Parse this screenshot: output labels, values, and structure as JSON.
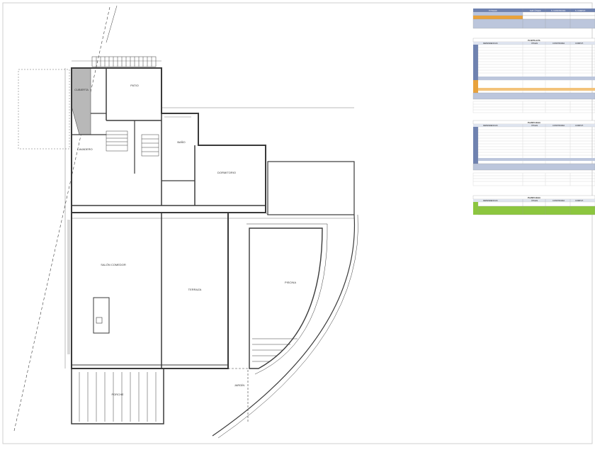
{
  "plan": {
    "rooms": {
      "cubierta": "CUBIERTA",
      "patio": "PATIO",
      "lavadero": "LAVADERO",
      "bano": "BAÑO",
      "dormitorio": "DORMITORIO",
      "salon": "SALÓN COMEDOR",
      "terraza": "TERRAZA",
      "piscina": "PISCINA",
      "porche": "PORCHE",
      "jardin": "JARDÍN"
    }
  },
  "tables": {
    "summary_headers": [
      "TOTALES",
      "SUP. ÚTILES",
      "S. CONSTRUIDA",
      "S. COMPUT."
    ],
    "alta_title": "PLANTA ALTA",
    "alta_headers": [
      "DEPENDENCIAS",
      "ÚTILES",
      "CONSTRUIDA",
      "COMPUT."
    ],
    "baja_title": "PLANTA BAJA",
    "baja_headers": [
      "DEPENDENCIAS",
      "ÚTILES",
      "CONSTRUIDA",
      "COMPUT."
    ],
    "baja2_title": "PLANTA BAJA",
    "baja2_headers": [
      "DEPENDENCIAS",
      "ÚTILES",
      "CONSTRUIDA",
      "COMPUT."
    ]
  },
  "colors": {
    "table_header": "#6f82b0",
    "total_band": "#bcc6dc",
    "accent_orange": "#e8a23c",
    "accent_green": "#8cc63f",
    "line": "#3a3a3a"
  }
}
